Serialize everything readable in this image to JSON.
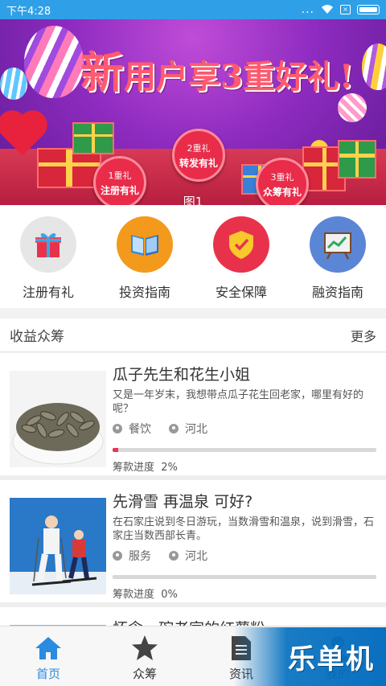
{
  "status_bar": {
    "time": "下午4:28",
    "dots": "...",
    "sim": "×"
  },
  "banner": {
    "title_main": "新",
    "title_rest_1": "用户享",
    "title_num": "3",
    "title_rest_2": "重好礼!",
    "gifts": [
      {
        "level": "1重礼",
        "title": "注册有礼"
      },
      {
        "level": "2重礼",
        "title": "转发有礼"
      },
      {
        "level": "3重礼",
        "title": "众筹有礼"
      }
    ],
    "caption": "图1"
  },
  "quick_nav": [
    {
      "label": "注册有礼",
      "icon": "gift-icon",
      "bg": "#e6e6e6"
    },
    {
      "label": "投资指南",
      "icon": "book-icon",
      "bg": "#f39a1c"
    },
    {
      "label": "安全保障",
      "icon": "shield-icon",
      "bg": "#e8324c"
    },
    {
      "label": "融资指南",
      "icon": "chart-board-icon",
      "bg": "#5b86d6"
    }
  ],
  "section": {
    "title": "收益众筹",
    "more": "更多"
  },
  "projects": [
    {
      "title": "瓜子先生和花生小姐",
      "desc": "又是一年岁末，我想带点瓜子花生回老家，哪里有好的呢？",
      "category": "餐饮",
      "location": "河北",
      "progress_label": "筹款进度",
      "progress_value": "2%",
      "progress_fraction": 0.02
    },
    {
      "title": "先滑雪 再温泉 可好?",
      "desc": "在石家庄说到冬日游玩，当数滑雪和温泉，说到滑雪，石家庄当数西部长青。",
      "category": "服务",
      "location": "河北",
      "progress_label": "筹款进度",
      "progress_value": "0%",
      "progress_fraction": 0
    },
    {
      "title": "怀念一碗老家的红薯粉"
    }
  ],
  "bottom_nav": [
    {
      "label": "首页",
      "icon": "home-icon",
      "active": true
    },
    {
      "label": "众筹",
      "icon": "star-icon",
      "active": false
    },
    {
      "label": "资讯",
      "icon": "document-icon",
      "active": false
    },
    {
      "label": "我的",
      "icon": "person-icon",
      "active": false
    }
  ],
  "watermark": "乐单机",
  "colors": {
    "accent": "#2a8be0",
    "status_bar": "#2fa0e8",
    "progress": "#e8335a"
  }
}
